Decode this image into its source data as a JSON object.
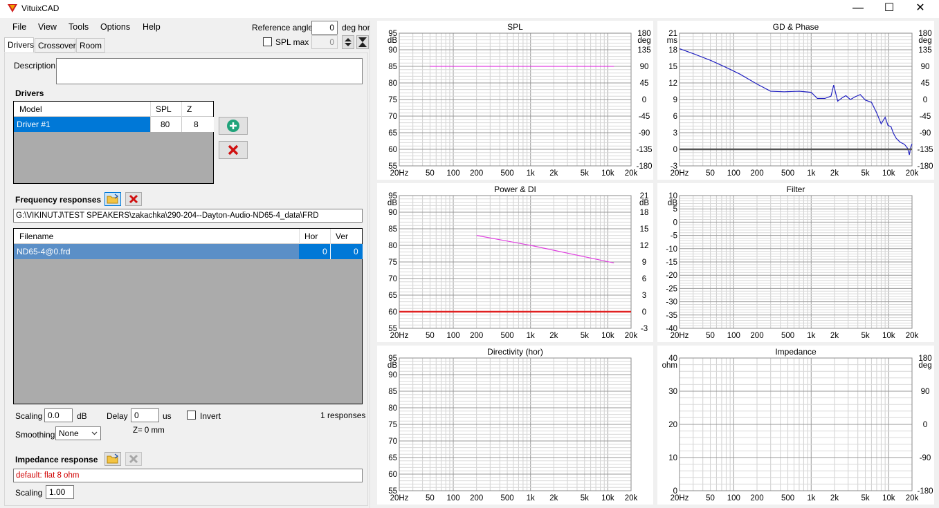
{
  "window": {
    "title": "VituixCAD",
    "controls": [
      "—",
      "☐",
      "✕"
    ]
  },
  "menu": [
    "File",
    "View",
    "Tools",
    "Options",
    "Help"
  ],
  "reference": {
    "label": "Reference angle",
    "value": "0",
    "unit": "deg hor",
    "spl_max_label": "SPL max",
    "spl_max_value": "0"
  },
  "tabs": [
    "Drivers",
    "Crossover",
    "Room"
  ],
  "description_label": "Description",
  "drivers": {
    "heading": "Drivers",
    "columns": [
      "Model",
      "SPL",
      "Z"
    ],
    "rows": [
      {
        "model": "Driver #1",
        "spl": "80",
        "z": "8"
      }
    ]
  },
  "freq": {
    "heading": "Frequency responses",
    "path": "G:\\VIKINUTJ\\TEST SPEAKERS\\zakachka\\290-204--Dayton-Audio-ND65-4_data\\FRD",
    "columns": [
      "Filename",
      "Hor",
      "Ver"
    ],
    "rows": [
      {
        "file": "ND65-4@0.frd",
        "hor": "0",
        "ver": "0"
      }
    ],
    "scaling_label": "Scaling",
    "scaling_value": "0.0",
    "scaling_unit": "dB",
    "delay_label": "Delay",
    "delay_value": "0",
    "delay_unit": "us",
    "invert_label": "Invert",
    "count": "1 responses",
    "smoothing_label": "Smoothing",
    "smoothing_value": "None",
    "z_text": "Z= 0 mm"
  },
  "impedance": {
    "heading": "Impedance response",
    "value": "default: flat 8 ohm",
    "scaling_label": "Scaling",
    "scaling_value": "1.00"
  },
  "x_ticks": [
    "20Hz",
    "50",
    "100",
    "200",
    "500",
    "1k",
    "2k",
    "5k",
    "10k",
    "20k"
  ],
  "charts": [
    {
      "id": "spl",
      "title": "SPL",
      "yl_unit": "dB",
      "yr_unit": "deg",
      "yl": [
        "95",
        "90",
        "85",
        "80",
        "75",
        "70",
        "65",
        "60",
        "55"
      ],
      "yr": [
        "180",
        "135",
        "90",
        "45",
        "0",
        "-45",
        "-90",
        "-135",
        "-180"
      ]
    },
    {
      "id": "gd",
      "title": "GD & Phase",
      "yl_unit": "ms",
      "yr_unit": "deg",
      "yl": [
        "21",
        "18",
        "15",
        "12",
        "9",
        "6",
        "3",
        "0",
        "-3"
      ],
      "yr": [
        "180",
        "135",
        "90",
        "45",
        "0",
        "-45",
        "-90",
        "-135",
        "-180"
      ]
    },
    {
      "id": "power",
      "title": "Power & DI",
      "yl_unit": "dB",
      "yr_unit": "dB",
      "yl": [
        "95",
        "90",
        "85",
        "80",
        "75",
        "70",
        "65",
        "60",
        "55"
      ],
      "yr": [
        "21",
        "18",
        "15",
        "12",
        "9",
        "6",
        "3",
        "0",
        "-3"
      ]
    },
    {
      "id": "filter",
      "title": "Filter",
      "yl_unit": "dB",
      "yr_unit": "",
      "yl": [
        "10",
        "5",
        "0",
        "-5",
        "-10",
        "-15",
        "-20",
        "-25",
        "-30",
        "-35",
        "-40"
      ],
      "yr": []
    },
    {
      "id": "directivity",
      "title": "Directivity (hor)",
      "yl_unit": "dB",
      "yr_unit": "",
      "yl": [
        "95",
        "90",
        "85",
        "80",
        "75",
        "70",
        "65",
        "60",
        "55"
      ],
      "yr": []
    },
    {
      "id": "impedance",
      "title": "Impedance",
      "yl_unit": "ohm",
      "yr_unit": "deg",
      "yl": [
        "40",
        "30",
        "20",
        "10",
        "0"
      ],
      "yr": [
        "180",
        "90",
        "0",
        "-90",
        "-180"
      ]
    }
  ],
  "chart_data": [
    {
      "type": "line",
      "title": "SPL",
      "xlabel": "",
      "ylabel": "dB",
      "xlim": [
        20,
        20000
      ],
      "ylim": [
        55,
        95
      ],
      "x_scale": "log",
      "series": [
        {
          "color": "#e040e0",
          "x": [
            50,
            12000
          ],
          "y": [
            85,
            85
          ]
        }
      ]
    },
    {
      "type": "line",
      "title": "GD & Phase",
      "xlabel": "",
      "ylabel": "ms",
      "xlim": [
        20,
        20000
      ],
      "ylim": [
        -3,
        21
      ],
      "x_scale": "log",
      "series": [
        {
          "color": "#2020c0",
          "x": [
            20,
            30,
            50,
            80,
            120,
            200,
            300,
            450,
            700,
            1000,
            1200,
            1500,
            1800,
            1950,
            2200,
            2500,
            2800,
            3200,
            3700,
            4300,
            5000,
            6000,
            7000,
            8000,
            9000,
            9800,
            10700,
            11500,
            12500,
            14000,
            16000,
            17500,
            18500,
            19200,
            20000
          ],
          "y": [
            18.2,
            17.3,
            16.1,
            14.8,
            13.6,
            11.8,
            10.5,
            10.4,
            10.5,
            10.3,
            9.2,
            9.2,
            9.6,
            11.6,
            8.7,
            9.3,
            9.7,
            9.0,
            9.5,
            9.9,
            8.9,
            8.5,
            6.6,
            4.6,
            5.8,
            4.3,
            4.1,
            2.9,
            2.0,
            1.3,
            0.9,
            0.2,
            -1.0,
            0.3,
            1.0
          ]
        },
        {
          "color": "#555555",
          "x": [
            20,
            20000
          ],
          "y": [
            0,
            0
          ]
        }
      ]
    },
    {
      "type": "line",
      "title": "Power & DI",
      "xlabel": "",
      "ylabel": "dB",
      "xlim": [
        20,
        20000
      ],
      "ylim": [
        55,
        95
      ],
      "x_scale": "log",
      "series": [
        {
          "color": "#e040e0",
          "x": [
            200,
            1000,
            12000
          ],
          "y": [
            83,
            80,
            74.7
          ]
        },
        {
          "color": "#e02020",
          "x": [
            20,
            20000
          ],
          "y": [
            60,
            60
          ]
        }
      ]
    }
  ]
}
